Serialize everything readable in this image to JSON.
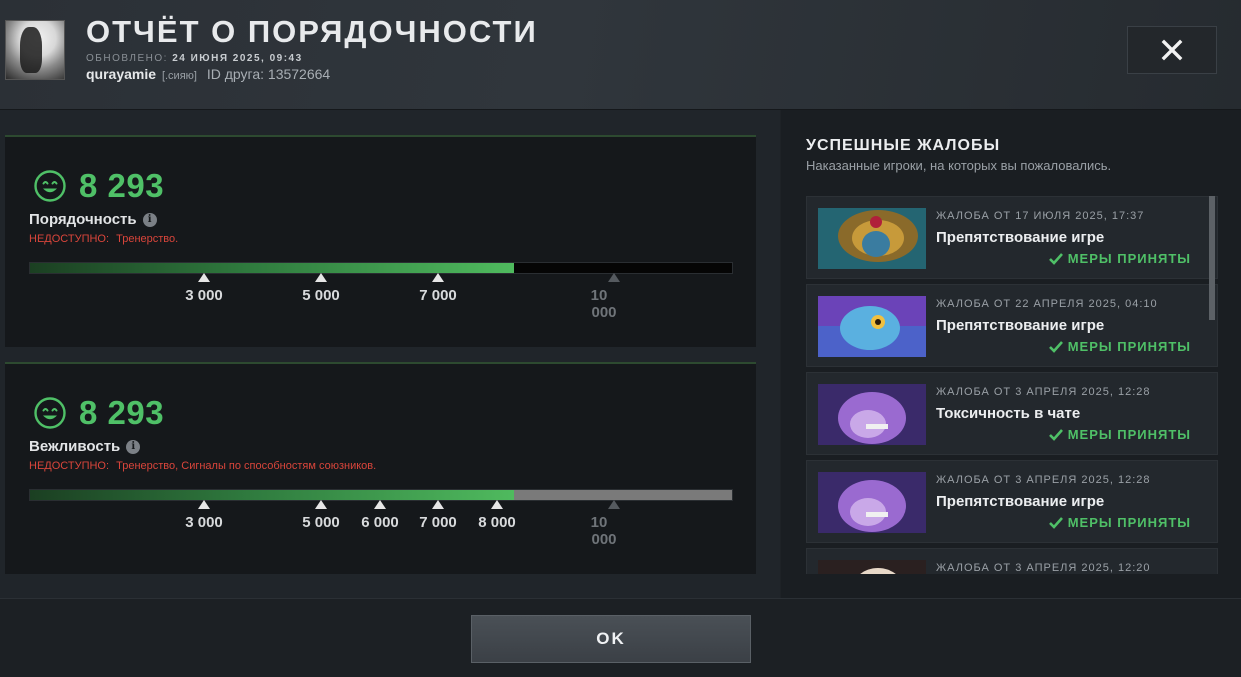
{
  "header": {
    "title": "ОТЧЁТ О ПОРЯДОЧНОСТИ",
    "updated_label": "ОБНОВЛЕНО:",
    "updated_value": "24 ИЮНЯ 2025, 09:43",
    "username": "qurayamie",
    "user_tag": "[.сияю]",
    "friend_id": "ID друга: 13572664",
    "close_icon": "close-icon"
  },
  "behavior": {
    "score": "8 293",
    "label": "Порядочность",
    "unavailable_label": "НЕДОСТУПНО:",
    "unavailable_reason": "Тренерство.",
    "bar_fill_fraction": 0.69,
    "bar_track_color": "#050505",
    "ticks": [
      "3 000",
      "5 000",
      "7 000"
    ],
    "max_tick": [
      "10",
      "000"
    ]
  },
  "communication": {
    "score": "8 293",
    "label": "Вежливость",
    "unavailable_label": "НЕДОСТУПНО:",
    "unavailable_reason": "Тренерство, Сигналы по способностям союзников.",
    "bar_fill_fraction": 0.69,
    "bar_track_color": "#7a7a7a",
    "ticks": [
      "3 000",
      "5 000",
      "6 000",
      "7 000",
      "8 000"
    ],
    "max_tick": [
      "10",
      "000"
    ]
  },
  "reports": {
    "title": "УСПЕШНЫЕ ЖАЛОБЫ",
    "subtitle": "Наказанные игроки, на которых вы пожаловались.",
    "items": [
      {
        "date": "ЖАЛОБА ОТ 17 ИЮЛЯ 2025, 17:37",
        "reason": "Препятствование игре",
        "status": "МЕРЫ ПРИНЯТЫ"
      },
      {
        "date": "ЖАЛОБА ОТ 22 АПРЕЛЯ 2025, 04:10",
        "reason": "Препятствование игре",
        "status": "МЕРЫ ПРИНЯТЫ"
      },
      {
        "date": "ЖАЛОБА ОТ 3 АПРЕЛЯ 2025, 12:28",
        "reason": "Токсичность в чате",
        "status": "МЕРЫ ПРИНЯТЫ"
      },
      {
        "date": "ЖАЛОБА ОТ 3 АПРЕЛЯ 2025, 12:28",
        "reason": "Препятствование игре",
        "status": "МЕРЫ ПРИНЯТЫ"
      },
      {
        "date": "ЖАЛОБА ОТ 3 АПРЕЛЯ 2025, 12:20",
        "reason": "",
        "status": ""
      }
    ]
  },
  "footer": {
    "ok_label": "OK"
  },
  "colors": {
    "score_green": "#4fc067",
    "unavailable_red": "#d9453b",
    "status_green": "#4fc067"
  }
}
